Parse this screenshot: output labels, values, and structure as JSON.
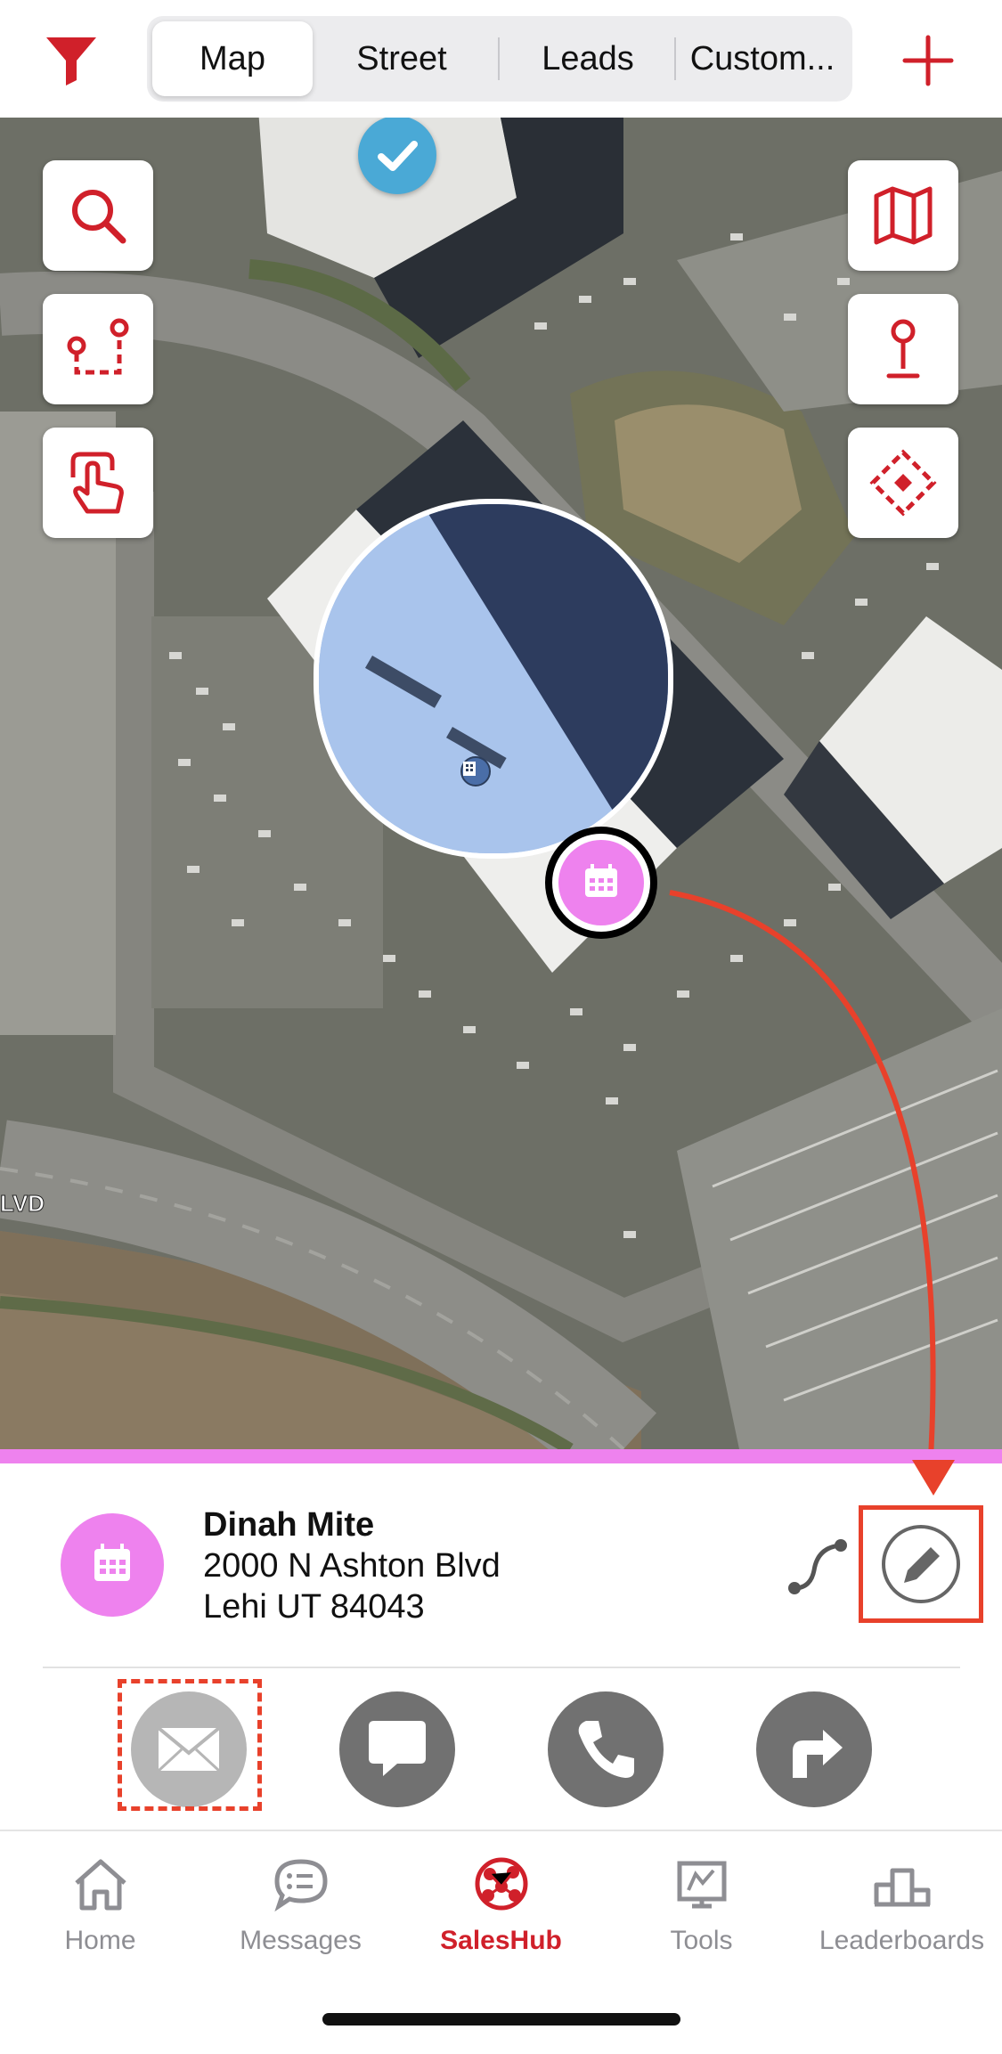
{
  "header": {
    "filter_icon": "filter-icon",
    "tabs": [
      {
        "label": "Map",
        "active": true
      },
      {
        "label": "Street",
        "active": false
      },
      {
        "label": "Leads",
        "active": false
      },
      {
        "label": "Custom...",
        "active": false
      }
    ],
    "add_icon": "plus-icon"
  },
  "map": {
    "street_label": "LVD",
    "left_tools": [
      "search-icon",
      "route-icon",
      "touch-icon"
    ],
    "right_tools": [
      "map-icon",
      "pin-icon",
      "area-select-icon"
    ],
    "marker_icon": "calendar-icon"
  },
  "colors": {
    "accent": "#d0202a",
    "status_pink": "#ee82ee",
    "annotation": "#e8412b"
  },
  "lead": {
    "name": "Dinah Mite",
    "address_line1": "2000 N Ashton Blvd",
    "address_line2": "Lehi UT 84043"
  },
  "actions": [
    "email-icon",
    "message-icon",
    "phone-icon",
    "directions-icon"
  ],
  "tabbar": {
    "items": [
      {
        "label": "Home",
        "active": false
      },
      {
        "label": "Messages",
        "active": false
      },
      {
        "label": "SalesHub",
        "active": true
      },
      {
        "label": "Tools",
        "active": false
      },
      {
        "label": "Leaderboards",
        "active": false
      }
    ]
  }
}
